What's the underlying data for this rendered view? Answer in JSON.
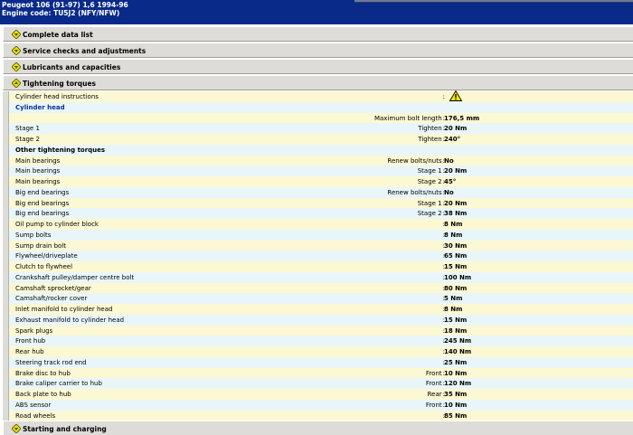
{
  "header": {
    "vehicle": "Peugeot   106 (91-97) 1,6   1994-96",
    "engine": "Engine code: TU5J2 (NFY/NFW)"
  },
  "sections": {
    "complete": "Complete data list",
    "service": "Service checks and adjustments",
    "lubricants": "Lubricants and capacities",
    "torques": "Tightening torques",
    "starting": "Starting and charging"
  },
  "icons": {
    "section_chevron": "chevron-down-icon",
    "warning": "warning-triangle-icon"
  },
  "colors": {
    "header_bg": "#0a2a8a",
    "row_odd": "#fbf8d3",
    "row_even": "#e9f6f9",
    "subheading": "#0b2e9b",
    "chevron": "#e8e400"
  },
  "rows": [
    {
      "label": "Cylinder head instructions",
      "cond": "",
      "sep": ":",
      "value": "",
      "warn": true
    },
    {
      "label": "Cylinder head",
      "type": "sub",
      "cond": "",
      "sep": "",
      "value": ""
    },
    {
      "label": "",
      "cond": "Maximum bolt length",
      "sep": ":",
      "value": "176,5 mm"
    },
    {
      "label": "Stage 1",
      "cond": "Tighten",
      "sep": ":",
      "value": "20 Nm"
    },
    {
      "label": "Stage 2",
      "cond": "Tighten",
      "sep": ":",
      "value": "240°"
    },
    {
      "label": "Other tightening torques",
      "type": "group",
      "cond": "",
      "sep": "",
      "value": ""
    },
    {
      "label": "Main bearings",
      "cond": "Renew bolts/nuts",
      "sep": ":",
      "value": "No"
    },
    {
      "label": "Main bearings",
      "cond": "Stage 1",
      "sep": ":",
      "value": "20 Nm"
    },
    {
      "label": "Main bearings",
      "cond": "Stage 2",
      "sep": ":",
      "value": "45°"
    },
    {
      "label": "Big end bearings",
      "cond": "Renew bolts/nuts",
      "sep": ":",
      "value": "No"
    },
    {
      "label": "Big end bearings",
      "cond": "Stage 1",
      "sep": ":",
      "value": "20 Nm"
    },
    {
      "label": "Big end bearings",
      "cond": "Stage 2",
      "sep": ":",
      "value": "38 Nm"
    },
    {
      "label": "Oil pump to cylinder block",
      "cond": "",
      "sep": ":",
      "value": "8 Nm"
    },
    {
      "label": "Sump bolts",
      "cond": "",
      "sep": ":",
      "value": "8 Nm"
    },
    {
      "label": "Sump drain bolt",
      "cond": "",
      "sep": ":",
      "value": "30 Nm"
    },
    {
      "label": "Flywheel/driveplate",
      "cond": "",
      "sep": ":",
      "value": "65 Nm"
    },
    {
      "label": "Clutch to flywheel",
      "cond": "",
      "sep": ":",
      "value": "15 Nm"
    },
    {
      "label": "Crankshaft pulley/damper centre bolt",
      "cond": "",
      "sep": ":",
      "value": "100 Nm"
    },
    {
      "label": "Camshaft sprocket/gear",
      "cond": "",
      "sep": ":",
      "value": "80 Nm"
    },
    {
      "label": "Camshaft/rocker cover",
      "cond": "",
      "sep": ":",
      "value": "5 Nm"
    },
    {
      "label": "Inlet manifold to cylinder head",
      "cond": "",
      "sep": ":",
      "value": "8 Nm"
    },
    {
      "label": "Exhaust manifold to cylinder head",
      "cond": "",
      "sep": ":",
      "value": "15 Nm"
    },
    {
      "label": "Spark plugs",
      "cond": "",
      "sep": ":",
      "value": "18 Nm"
    },
    {
      "label": "Front hub",
      "cond": "",
      "sep": ":",
      "value": "245 Nm"
    },
    {
      "label": "Rear hub",
      "cond": "",
      "sep": ":",
      "value": "140 Nm"
    },
    {
      "label": "Steering track rod end",
      "cond": "",
      "sep": ":",
      "value": "25 Nm"
    },
    {
      "label": "Brake disc to hub",
      "cond": "Front",
      "sep": ":",
      "value": "10 Nm"
    },
    {
      "label": "Brake caliper carrier to hub",
      "cond": "Front",
      "sep": ":",
      "value": "120 Nm"
    },
    {
      "label": "Back plate to hub",
      "cond": "Rear",
      "sep": ":",
      "value": "35 Nm"
    },
    {
      "label": "ABS sensor",
      "cond": "Front",
      "sep": ":",
      "value": "10 Nm"
    },
    {
      "label": "Road wheels",
      "cond": "",
      "sep": ":",
      "value": "85 Nm"
    }
  ]
}
